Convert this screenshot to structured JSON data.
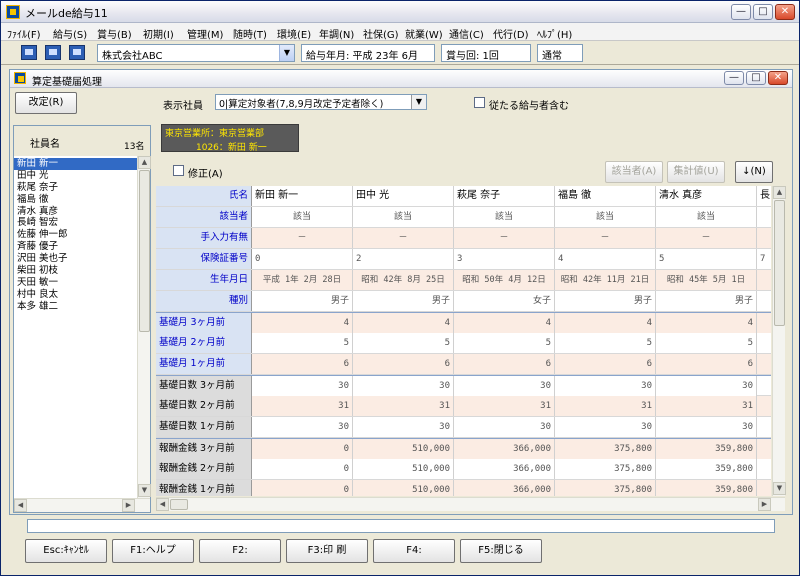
{
  "app": {
    "title": "メールde給与11",
    "min": "—",
    "max": "□",
    "close": "✕"
  },
  "menu": [
    "ﾌｧｲﾙ(F)",
    "給与(S)",
    "賞与(B)",
    "初期(I)",
    "管理(M)",
    "随時(T)",
    "環境(E)",
    "年調(N)",
    "社保(G)",
    "就業(W)",
    "通信(C)",
    "代行(D)",
    "ﾍﾙﾌﾟ(H)"
  ],
  "toolbar": {
    "company": "株式会社ABC",
    "pay_month": "給与年月: 平成 23年  6月",
    "bonus_count": "賞与回: 1回",
    "mode": "通常"
  },
  "window": {
    "title": "算定基礎届処理"
  },
  "controls": {
    "edit_button": "改定(R)",
    "display_label": "表示社員",
    "display_value": "0|算定対象者(7,8,9月改定予定者除く)",
    "include_dependents": "従たる給与者含む",
    "correction": "修正(A)",
    "applicable_button": "該当者(A)",
    "calc_button": "集計値(U)",
    "down_button": "↓(N)"
  },
  "employee_panel": {
    "header": "社員名",
    "count": "13名",
    "items": [
      "新田  新一",
      "田中  光",
      "萩尾  奈子",
      "福島  徹",
      "清水  真彦",
      "長崎  智宏",
      "佐藤  伸一郎",
      "斉藤  優子",
      "沢田  美也子",
      "柴田  初枝",
      "天田  敏一",
      "村中  良太",
      "本多  雄二"
    ],
    "selected": 0
  },
  "info": {
    "office": "東京営業所：東京営業部",
    "employee": "1026：新田  新一"
  },
  "grid": {
    "columns": [
      "新田  新一",
      "田中  光",
      "萩尾  奈子",
      "福島  徹",
      "清水  真彦",
      "長"
    ],
    "rows": [
      {
        "label": "氏名",
        "style": "blue",
        "cells": [
          "新田  新一",
          "田中  光",
          "萩尾  奈子",
          "福島  徹",
          "清水  真彦",
          "長"
        ],
        "align": "hdr"
      },
      {
        "label": "該当者",
        "style": "blue",
        "cells": [
          "該当",
          "該当",
          "該当",
          "該当",
          "該当",
          ""
        ],
        "align": "ctr",
        "bg": "white"
      },
      {
        "label": "手入力有無",
        "style": "blue",
        "cells": [
          "－",
          "－",
          "－",
          "－",
          "－",
          ""
        ],
        "align": "ctr",
        "bg": "pink"
      },
      {
        "label": "保険証番号",
        "style": "blue",
        "cells": [
          "0",
          "2",
          "3",
          "4",
          "5",
          "7"
        ],
        "align": "lft",
        "bg": "white"
      },
      {
        "label": "生年月日",
        "style": "blue",
        "cells": [
          "平成 1年 2月 28日",
          "昭和 42年 8月 25日",
          "昭和 50年 4月 12日",
          "昭和 42年 11月 21日",
          "昭和 45年 5月 1日",
          ""
        ],
        "align": "ctr",
        "bg": "pink"
      },
      {
        "label": "種別",
        "style": "blue",
        "cells": [
          "男子",
          "男子",
          "女子",
          "男子",
          "男子",
          ""
        ],
        "align": "num",
        "bg": "white"
      },
      {
        "label": "基礎月    3ヶ月前",
        "style": "blue2",
        "cells": [
          "4",
          "4",
          "4",
          "4",
          "4",
          ""
        ],
        "align": "num",
        "bg": "pink"
      },
      {
        "label": "基礎月    2ヶ月前",
        "style": "blue2",
        "cells": [
          "5",
          "5",
          "5",
          "5",
          "5",
          ""
        ],
        "align": "num",
        "bg": "white"
      },
      {
        "label": "基礎月    1ヶ月前",
        "style": "blue2",
        "cells": [
          "6",
          "6",
          "6",
          "6",
          "6",
          ""
        ],
        "align": "num",
        "bg": "pink"
      },
      {
        "label": "基礎日数  3ヶ月前",
        "style": "grey",
        "cells": [
          "30",
          "30",
          "30",
          "30",
          "30",
          ""
        ],
        "align": "num",
        "bg": "white"
      },
      {
        "label": "基礎日数  2ヶ月前",
        "style": "grey",
        "cells": [
          "31",
          "31",
          "31",
          "31",
          "31",
          ""
        ],
        "align": "num",
        "bg": "pink"
      },
      {
        "label": "基礎日数  1ヶ月前",
        "style": "grey",
        "cells": [
          "30",
          "30",
          "30",
          "30",
          "30",
          ""
        ],
        "align": "num",
        "bg": "white"
      },
      {
        "label": "報酬金銭  3ヶ月前",
        "style": "grey",
        "cells": [
          "0",
          "510,000",
          "366,000",
          "375,800",
          "359,800",
          ""
        ],
        "align": "num",
        "bg": "pink"
      },
      {
        "label": "報酬金銭  2ヶ月前",
        "style": "grey",
        "cells": [
          "0",
          "510,000",
          "366,000",
          "375,800",
          "359,800",
          ""
        ],
        "align": "num",
        "bg": "white"
      },
      {
        "label": "報酬金銭  1ヶ月前",
        "style": "grey",
        "cells": [
          "0",
          "510,000",
          "366,000",
          "375,800",
          "359,800",
          ""
        ],
        "align": "num",
        "bg": "pink"
      }
    ]
  },
  "fkeys": [
    "Esc:ｷｬﾝｾﾙ",
    "F1:ヘルプ",
    "F2:",
    "F3:印  刷",
    "F4:",
    "F5:閉じる"
  ],
  "colors": {
    "accent": "#0000c8",
    "selection": "#316ac5",
    "info_bg": "#5a5a5a",
    "info_text": "#ffe600"
  }
}
